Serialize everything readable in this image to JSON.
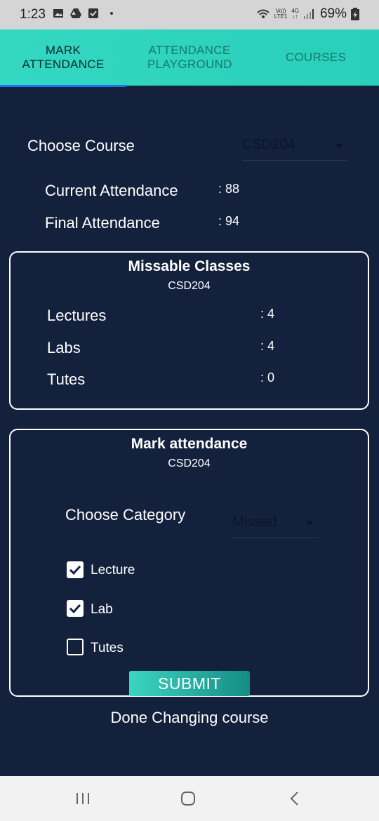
{
  "status_bar": {
    "time": "1:23",
    "network_top": "Vo))",
    "network_bottom": "LTE1",
    "net_type": "4G",
    "battery": "69%"
  },
  "tabs": [
    {
      "label": "MARK ATTENDANCE",
      "active": true
    },
    {
      "label": "ATTENDANCE PLAYGROUND",
      "active": false
    },
    {
      "label": "COURSES",
      "active": false
    }
  ],
  "course": {
    "label": "Choose Course",
    "selected": "CSD204"
  },
  "attendance": {
    "current_label": "Current Attendance",
    "current_value": ": 88",
    "final_label": "Final Attendance",
    "final_value": ": 94"
  },
  "missable": {
    "title": "Missable Classes",
    "course": "CSD204",
    "rows": [
      {
        "label": "Lectures",
        "value": ": 4"
      },
      {
        "label": "Labs",
        "value": ": 4"
      },
      {
        "label": "Tutes",
        "value": ": 0"
      }
    ]
  },
  "mark": {
    "title": "Mark attendance",
    "course": "CSD204",
    "category_label": "Choose Category",
    "category_selected": "Missed",
    "options": [
      {
        "label": "Lecture",
        "checked": true
      },
      {
        "label": "Lab",
        "checked": true
      },
      {
        "label": "Tutes",
        "checked": false
      }
    ],
    "submit_label": "SUBMIT"
  },
  "done_label": "Done Changing course"
}
